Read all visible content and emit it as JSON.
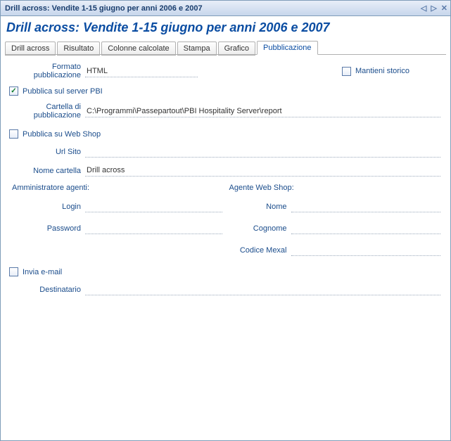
{
  "window": {
    "title": "Drill across: Vendite 1-15 giugno per anni 2006 e 2007"
  },
  "heading": "Drill across: Vendite 1-15 giugno per anni 2006 e 2007",
  "tabs": [
    {
      "label": "Drill across"
    },
    {
      "label": "Risultato"
    },
    {
      "label": "Colonne calcolate"
    },
    {
      "label": "Stampa"
    },
    {
      "label": "Grafico"
    },
    {
      "label": "Pubblicazione"
    }
  ],
  "form": {
    "formato_label": "Formato pubblicazione",
    "formato_value": "HTML",
    "mantieni_storico_label": "Mantieni storico",
    "mantieni_storico_checked": false,
    "pubblica_pbi_label": "Pubblica sul server PBI",
    "pubblica_pbi_checked": true,
    "cartella_pub_label": "Cartella di pubblicazione",
    "cartella_pub_value": "C:\\Programmi\\Passepartout\\PBI Hospitality Server\\report",
    "pubblica_ws_label": "Pubblica su Web Shop",
    "pubblica_ws_checked": false,
    "url_sito_label": "Url Sito",
    "url_sito_value": "",
    "nome_cartella_label": "Nome cartella",
    "nome_cartella_value": "Drill across",
    "admin_agenti_header": "Amministratore agenti:",
    "agente_ws_header": "Agente Web Shop:",
    "login_label": "Login",
    "login_value": "",
    "password_label": "Password",
    "password_value": "",
    "nome_label": "Nome",
    "nome_value": "",
    "cognome_label": "Cognome",
    "cognome_value": "",
    "codice_mexal_label": "Codice Mexal",
    "codice_mexal_value": "",
    "invia_email_label": "Invia e-mail",
    "invia_email_checked": false,
    "destinatario_label": "Destinatario",
    "destinatario_value": ""
  }
}
